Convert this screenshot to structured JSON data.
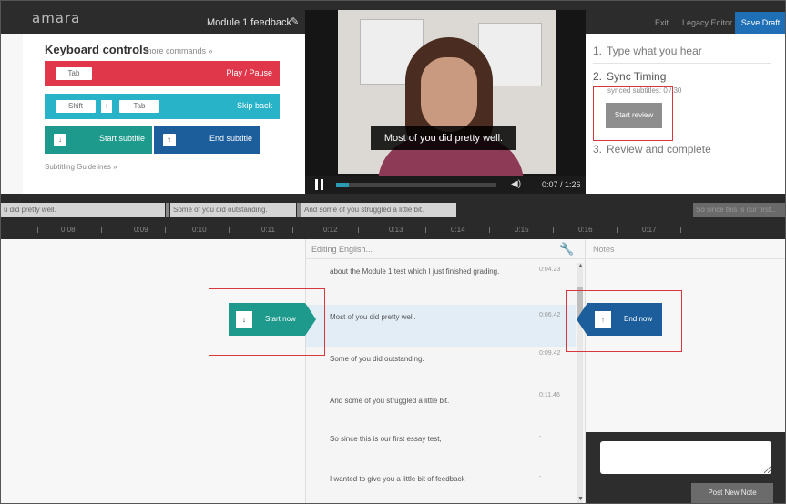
{
  "app": {
    "logo": "amara",
    "video_title": "Module 1 feedback",
    "top_links": {
      "exit": "Exit",
      "legacy": "Legacy Editor"
    },
    "save_draft": "Save Draft"
  },
  "keyboard": {
    "title": "Keyboard controls",
    "more": "more commands »",
    "rows": [
      {
        "keys": [
          "Tab"
        ],
        "action": "Play / Pause",
        "color": "#e0374b"
      },
      {
        "keys": [
          "Shift",
          "+",
          "Tab"
        ],
        "action": "Skip back",
        "color": "#29b3c9"
      },
      {
        "keys": [
          "↓"
        ],
        "action": "Start subtitle",
        "color": "#1e9a8c"
      },
      {
        "keys": [
          "↑"
        ],
        "action": "End subtitle",
        "color": "#1c5e9c"
      }
    ],
    "guidelines": "Subtitling Guidelines »"
  },
  "video": {
    "caption": "Most of you did pretty well.",
    "time": "0:07 / 1:26",
    "progress_fraction": 0.08
  },
  "steps": {
    "step1": {
      "num": "1.",
      "label": "Type what you hear"
    },
    "step2": {
      "num": "2.",
      "label": "Sync Timing"
    },
    "synced": "synced subtitles: 0 / 30",
    "start_review": "Start review",
    "step3": {
      "num": "3.",
      "label": "Review and complete"
    }
  },
  "timeline": {
    "segments": [
      "u did pretty well.",
      "Some of you did outstanding.",
      "And some of you struggled a little bit.",
      "So since this is our first..."
    ],
    "ruler": [
      "0:08",
      "0:09",
      "0:10",
      "0:11",
      "0:12",
      "0:13",
      "0:14",
      "0:15",
      "0:16",
      "0:17"
    ]
  },
  "editor": {
    "header": "Editing English...",
    "subtitles": [
      {
        "text": "about the Module 1 test which I just finished grading.",
        "time": "0:04.23"
      },
      {
        "text": "Most of you did pretty well.",
        "time": "0:06.42"
      },
      {
        "text": "Some of you did outstanding.",
        "time": "0:09.42"
      },
      {
        "text": "And some of you struggled a little bit.",
        "time": "0:11.46"
      },
      {
        "text": "So since this is our first essay test,",
        "time": "-"
      },
      {
        "text": "I wanted to give you a little bit of feedback",
        "time": "-"
      }
    ]
  },
  "sync": {
    "start_now": "Start now",
    "end_now": "End now"
  },
  "notes": {
    "label": "Notes",
    "post": "Post New Note"
  }
}
